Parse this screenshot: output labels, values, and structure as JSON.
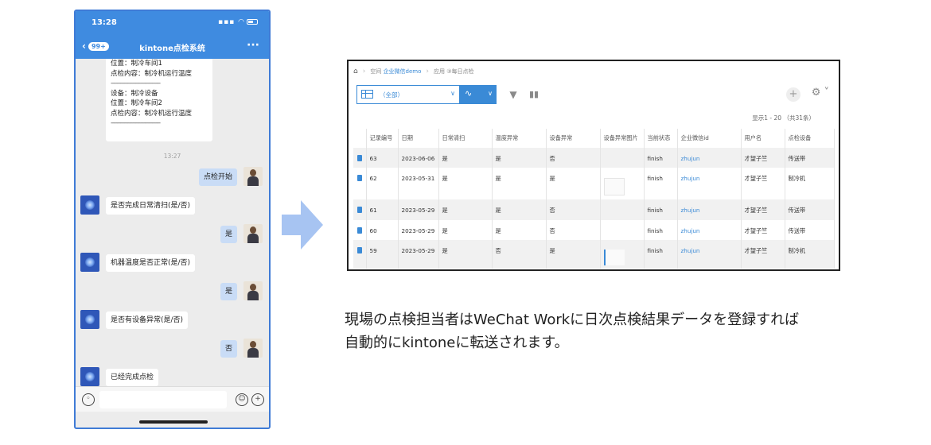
{
  "phone": {
    "status_time": "13:28",
    "back_badge": "99+",
    "title": "kintone点检系统",
    "more": "···",
    "card_lines": [
      "位置：制冷车间1",
      "点检内容：制冷机运行温度",
      "------------------------------",
      "设备：制冷设备",
      "位置：制冷车间2",
      "点检内容：制冷机运行温度",
      "------------------------------"
    ],
    "chat_time": "13:27",
    "messages": [
      {
        "side": "right",
        "text": "点检开始"
      },
      {
        "side": "left",
        "text": "是否完成日常清扫(是/否)"
      },
      {
        "side": "right",
        "text": "是"
      },
      {
        "side": "left",
        "text": "机器温度是否正常(是/否)"
      },
      {
        "side": "right",
        "text": "是"
      },
      {
        "side": "left",
        "text": "是否有设备异常(是/否)"
      },
      {
        "side": "right",
        "text": "否"
      },
      {
        "side": "left",
        "text": "已经完成点检"
      }
    ]
  },
  "kintone": {
    "breadcrumb": {
      "space_prefix": "空间",
      "space_link": "企业微信demo",
      "app_prefix": "应用",
      "app_name": "③每日点检"
    },
    "view_label": "（全部）",
    "record_count": "显示1 - 20 （共31条）",
    "columns": [
      "记录编号",
      "日期",
      "日常清扫",
      "温度异常",
      "设备异常",
      "设备异常图片",
      "当前状态",
      "企业微信id",
      "用户名",
      "点检设备"
    ],
    "rows": [
      {
        "id": "63",
        "date": "2023-06-06",
        "clean": "是",
        "temp": "是",
        "device": "否",
        "image": "",
        "status": "finish",
        "wechat_id": "zhujun",
        "user": "才望子竺",
        "equipment": "传送带"
      },
      {
        "id": "62",
        "date": "2023-05-31",
        "clean": "是",
        "temp": "是",
        "device": "是",
        "image": "thumb",
        "status": "finish",
        "wechat_id": "zhujun",
        "user": "才望子竺",
        "equipment": "制冷机"
      },
      {
        "id": "61",
        "date": "2023-05-29",
        "clean": "是",
        "temp": "是",
        "device": "否",
        "image": "",
        "status": "finish",
        "wechat_id": "zhujun",
        "user": "才望子竺",
        "equipment": "传送带"
      },
      {
        "id": "60",
        "date": "2023-05-29",
        "clean": "是",
        "temp": "是",
        "device": "否",
        "image": "",
        "status": "finish",
        "wechat_id": "zhujun",
        "user": "才望子竺",
        "equipment": "传送带"
      },
      {
        "id": "59",
        "date": "2023-05-29",
        "clean": "是",
        "temp": "否",
        "device": "是",
        "image": "thumb-lines",
        "status": "finish",
        "wechat_id": "zhujun",
        "user": "才望子竺",
        "equipment": "制冷机"
      }
    ]
  },
  "caption": {
    "line1": "現場の点検担当者はWeChat Workに日次点検結果データを登録すれば",
    "line2": "自動的にkintoneに転送されます。"
  },
  "colors": {
    "wechat_blue": "#3f8be0",
    "kintone_blue": "#3a8ad6",
    "arrow": "#a7c4f2"
  }
}
